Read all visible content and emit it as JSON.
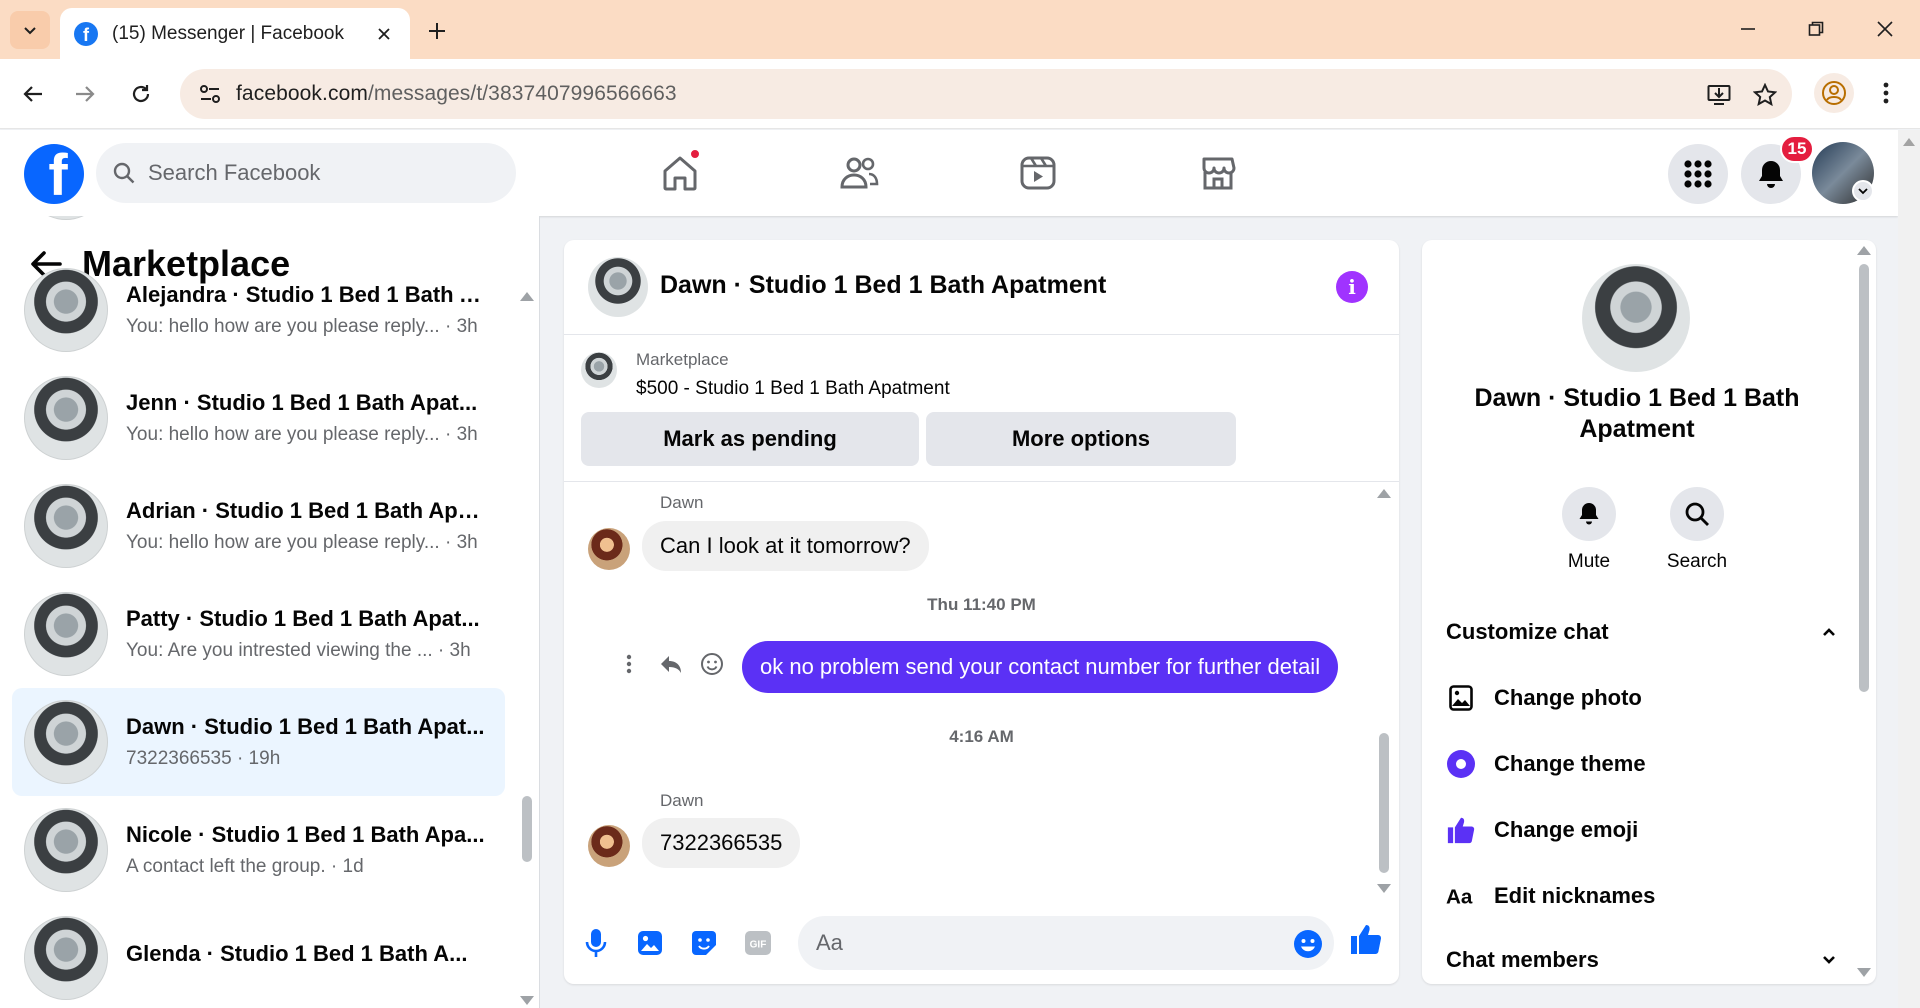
{
  "browser": {
    "tab_title": "(15) Messenger | Facebook",
    "url_host": "facebook.com",
    "url_path": "/messages/t/3837407996566663"
  },
  "fb": {
    "search_placeholder": "Search Facebook",
    "notification_count": "15",
    "accent": "#0866ff"
  },
  "left": {
    "title": "Marketplace",
    "conversations": [
      {
        "name": "Alejandra · Studio 1 Bed 1 Bath A...",
        "preview": "You: hello how are you please reply... · 3h"
      },
      {
        "name": "Jenn · Studio 1 Bed 1 Bath Apat...",
        "preview": "You: hello how are you please reply... · 3h"
      },
      {
        "name": "Adrian · Studio 1 Bed 1 Bath Apa...",
        "preview": "You: hello how are you please reply... · 3h"
      },
      {
        "name": "Patty · Studio 1 Bed 1 Bath Apat...",
        "preview": "You: Are you intrested viewing the ... · 3h"
      },
      {
        "name": "Dawn · Studio 1 Bed 1 Bath Apat...",
        "preview": "7322366535 · 19h"
      },
      {
        "name": "Nicole · Studio 1 Bed 1 Bath Apa...",
        "preview": "A contact left the group. · 1d"
      },
      {
        "name": "Glenda · Studio 1 Bed 1 Bath A...",
        "preview": ""
      }
    ]
  },
  "chat": {
    "title": "Dawn · Studio 1 Bed 1 Bath Apatment",
    "info_icon": "i",
    "marketplace_label": "Marketplace",
    "listing": "$500 - Studio 1 Bed 1 Bath Apatment",
    "mark_pending": "Mark as pending",
    "more_options": "More options",
    "messages": [
      {
        "sender": "Dawn",
        "text": "Can I look at it tomorrow?"
      },
      {
        "timestamp": "Thu 11:40 PM"
      },
      {
        "text": "ok no problem send your contact number for further detail"
      },
      {
        "timestamp": "4:16 AM"
      },
      {
        "sender": "Dawn",
        "text": "7322366535"
      }
    ],
    "composer_placeholder": "Aa",
    "outgoing_color": "#5b31f5"
  },
  "right": {
    "name": "Dawn · Studio 1 Bed 1 Bath Apatment",
    "mute": "Mute",
    "search": "Search",
    "customize_chat": "Customize chat",
    "items": [
      "Change photo",
      "Change theme",
      "Change emoji",
      "Edit nicknames"
    ],
    "chat_members": "Chat members"
  }
}
